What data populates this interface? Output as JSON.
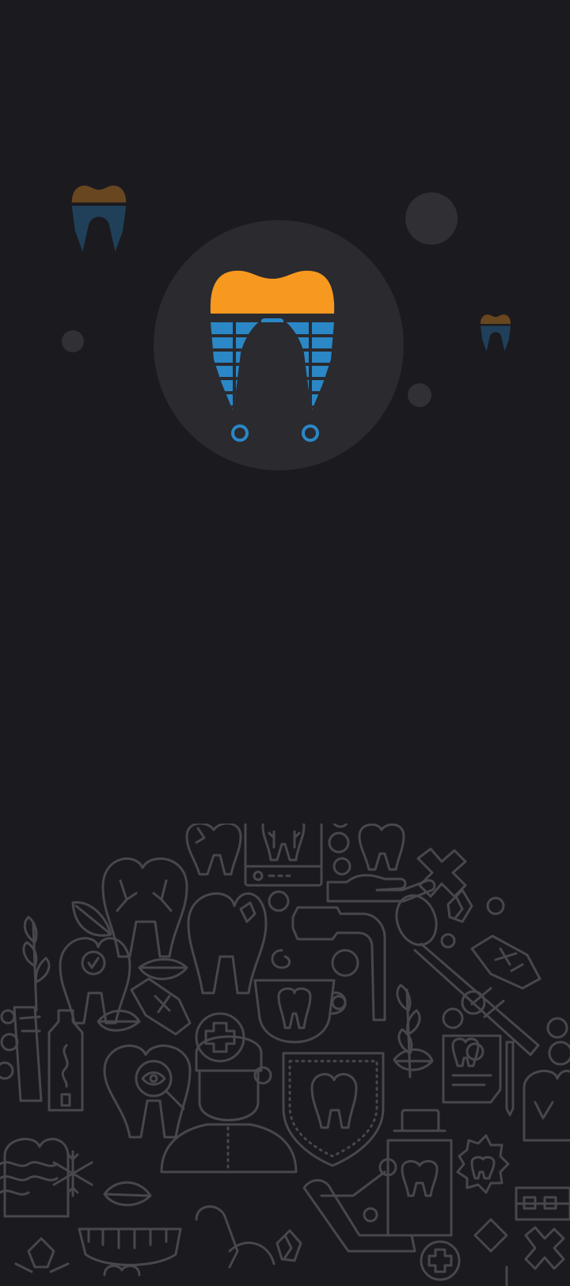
{
  "app": {
    "screen_type": "splash",
    "logo_icon": "tooth-logo-icon",
    "decor_icons": [
      "tooth-icon",
      "x-ray-tooth-icon",
      "cross-icon",
      "mirror-tool-icon",
      "toothbrush-icon",
      "toothpaste-icon",
      "dentist-icon",
      "shield-tooth-icon",
      "mouthwash-bottle-icon",
      "dental-chair-icon",
      "leaf-icon",
      "snowflake-icon",
      "braces-icon",
      "dental-record-icon",
      "coffee-cup-tooth-icon",
      "magnifier-eye-icon"
    ]
  },
  "colors": {
    "background": "#1b1a1f",
    "logo_circle": "#2a2a2f",
    "tooth_crown": "#f7981f",
    "tooth_grid": "#2b87c6",
    "bubble": "#2f2f34",
    "bubble_light": "#4a4a4f",
    "pattern_line": "#47474d"
  }
}
